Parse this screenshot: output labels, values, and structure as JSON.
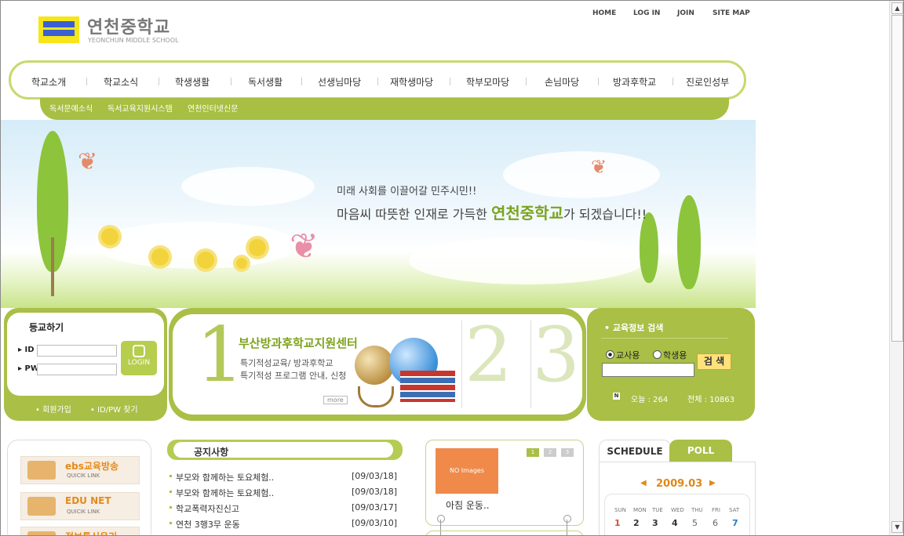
{
  "header": {
    "logo_title": "연천중학교",
    "logo_sub": "YEONCHUN MIDDLE SCHOOL",
    "top_links": [
      "HOME",
      "LOG IN",
      "JOIN",
      "SITE MAP"
    ]
  },
  "nav": {
    "items": [
      "학교소개",
      "학교소식",
      "학생생활",
      "독서생활",
      "선생님마당",
      "재학생마당",
      "학부모마당",
      "손님마당",
      "방과후학교",
      "진로인성부"
    ],
    "sub_items": [
      "독서문예소식",
      "독서교육지원시스템",
      "연천인터넷신문"
    ]
  },
  "hero": {
    "line1": "미래 사회를 이끌어갈 민주시민!!",
    "line2_pre": "마음씨 따뜻한 인재로 가득한 ",
    "line2_em": "연천중학교",
    "line2_post": "가 되겠습니다!!"
  },
  "login": {
    "title": "등교하기",
    "id_label": "ID",
    "pw_label": "PW",
    "button": "LOGIN",
    "join": "회원가입",
    "find": "ID/PW 찾기"
  },
  "banner": {
    "num_active": "1",
    "num2": "2",
    "num3": "3",
    "title": "부산방과후학교지원센터",
    "desc1": "특기적성교육/ 방과후학교",
    "desc2": "특기적성 프로그램 안내, 신청",
    "more": "more"
  },
  "search": {
    "title": "교육정보 검색",
    "radio_teacher": "교사용",
    "radio_student": "학생용",
    "button": "검 색",
    "n_badge": "N",
    "today": "오늘 : 264",
    "total": "전체 : 10863"
  },
  "quick_links": [
    {
      "title": "ebs교육방송",
      "sub": "QUICIK LINK"
    },
    {
      "title": "EDU NET",
      "sub": "QUICIK LINK"
    },
    {
      "title": "정보통신윤리",
      "sub": ""
    }
  ],
  "notices": {
    "title": "공지사항",
    "items": [
      {
        "title": "부모와 함께하는 토요체험..",
        "date": "[09/03/18]"
      },
      {
        "title": "부모와 함께하는 토요체험..",
        "date": "[09/03/18]"
      },
      {
        "title": "학교폭력자진신고",
        "date": "[09/03/17]"
      },
      {
        "title": "연천 3행3무 운동",
        "date": "[09/03/10]"
      }
    ]
  },
  "photo": {
    "image_text": "NO Images",
    "caption": "아침 운동..",
    "pages": [
      "1",
      "2",
      "3"
    ],
    "accent": "#a9bf46"
  },
  "schedule": {
    "tab_schedule": "SCHEDULE",
    "tab_poll": "POLL",
    "month": "2009.03",
    "day_names": [
      "SUN",
      "MON",
      "TUE",
      "WED",
      "THU",
      "FRI",
      "SAT"
    ],
    "days": [
      "1",
      "2",
      "3",
      "4",
      "5",
      "6",
      "7"
    ]
  },
  "colors": {
    "brand_green": "#a9bf46",
    "nav_border": "#c6d970",
    "accent_orange": "#e08719"
  }
}
